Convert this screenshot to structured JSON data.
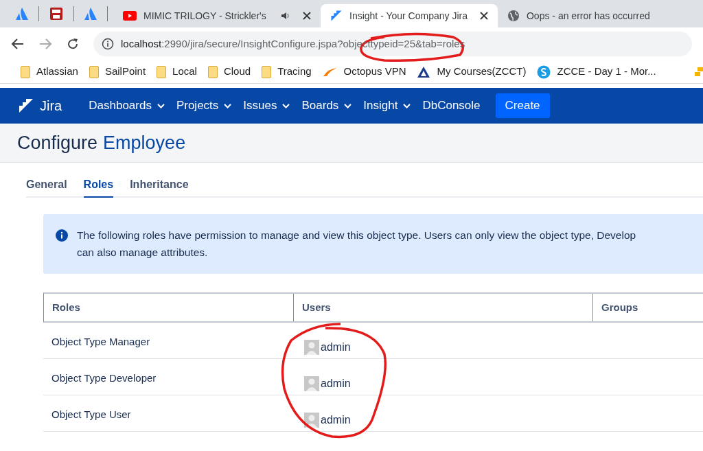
{
  "browser_tabs": [
    {
      "title": "MIMIC TRILOGY - Strickler's",
      "kind": "youtube",
      "audio": true,
      "selected": false
    },
    {
      "title": "Insight - Your Company Jira",
      "kind": "jira",
      "audio": false,
      "selected": true
    },
    {
      "title": "Oops - an error has occurred",
      "kind": "globe",
      "audio": false,
      "selected": false
    }
  ],
  "address_bar": {
    "host": "localhost",
    "rest": ":2990/jira/secure/InsightConfigure.jspa?objecttypeid=25&tab=roles"
  },
  "bookmarks": [
    {
      "label": "Atlassian",
      "kind": "folder"
    },
    {
      "label": "SailPoint",
      "kind": "folder"
    },
    {
      "label": "Local",
      "kind": "folder"
    },
    {
      "label": "Cloud",
      "kind": "folder"
    },
    {
      "label": "Tracing",
      "kind": "folder"
    },
    {
      "label": "Octopus VPN",
      "kind": "octopus"
    },
    {
      "label": "My Courses(ZCCT)",
      "kind": "atlassian"
    },
    {
      "label": "ZCCE - Day 1 - Mor...",
      "kind": "skype"
    }
  ],
  "jira_header": {
    "logo": "Jira",
    "nav": [
      {
        "label": "Dashboards",
        "has_menu": true
      },
      {
        "label": "Projects",
        "has_menu": true
      },
      {
        "label": "Issues",
        "has_menu": true
      },
      {
        "label": "Boards",
        "has_menu": true
      },
      {
        "label": "Insight",
        "has_menu": true
      },
      {
        "label": "DbConsole",
        "has_menu": false
      }
    ],
    "create_button": "Create"
  },
  "page_title": {
    "prefix": "Configure",
    "object_type": "Employee"
  },
  "tabs": [
    {
      "label": "General",
      "selected": false
    },
    {
      "label": "Roles",
      "selected": true
    },
    {
      "label": "Inheritance",
      "selected": false
    }
  ],
  "info_message": {
    "line_1": "The following roles have permission to manage and view this object type. Users can only view the object type, Develop",
    "line_2": "can also manage attributes."
  },
  "table": {
    "columns": [
      "Roles",
      "Users",
      "Groups"
    ],
    "rows": [
      {
        "role": "Object Type Manager",
        "users": [
          "admin"
        ]
      },
      {
        "role": "Object Type Developer",
        "users": [
          "admin"
        ]
      },
      {
        "role": "Object Type User",
        "users": [
          "admin"
        ]
      }
    ]
  }
}
